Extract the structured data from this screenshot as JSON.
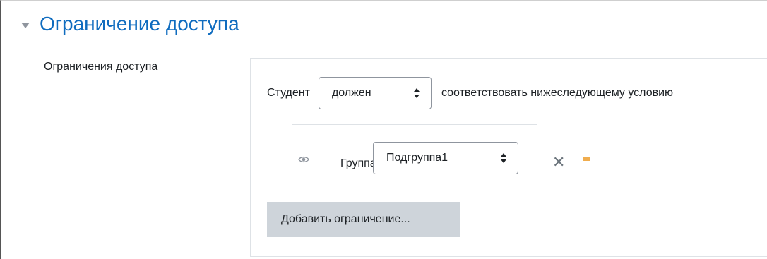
{
  "section": {
    "title": "Ограничение доступа",
    "toggle_icon": "triangle-down-icon"
  },
  "field": {
    "label": "Ограничения доступа"
  },
  "restriction": {
    "prefix": "Студент",
    "must_select": "должен",
    "suffix": "соответствовать нижеследующему условию",
    "condition": {
      "eye_icon": "eye-icon",
      "type_label": "Группа",
      "group_select": "Подгруппа1",
      "delete_icon": "close-icon",
      "extra_icon": "minus-icon"
    },
    "add_button": "Добавить ограничение..."
  },
  "colors": {
    "accent": "#0f6cbf",
    "warning": "#f0ad4e",
    "button_bg": "#ced4da"
  }
}
